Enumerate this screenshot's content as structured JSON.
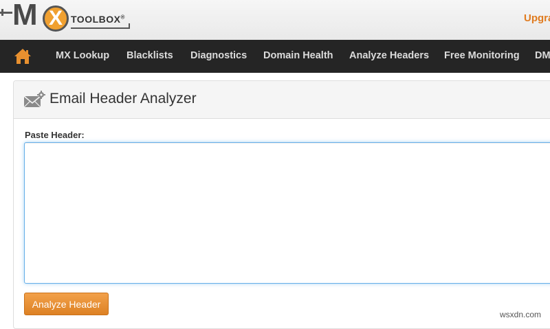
{
  "logo": {
    "brand_mx_m": "M",
    "brand_mx_x": "X",
    "brand_text": "TOOLBOX",
    "registered": "®"
  },
  "header": {
    "upgrade_label": "Upgra"
  },
  "nav": {
    "items": [
      {
        "label": "MX Lookup"
      },
      {
        "label": "Blacklists"
      },
      {
        "label": "Diagnostics"
      },
      {
        "label": "Domain Health"
      },
      {
        "label": "Analyze Headers"
      },
      {
        "label": "Free Monitoring"
      },
      {
        "label": "DM"
      }
    ]
  },
  "panel": {
    "title": "Email Header Analyzer",
    "field_label": "Paste Header:",
    "header_value": "",
    "button_label": "Analyze Header"
  },
  "watermark": "wsxdn.com",
  "colors": {
    "accent": "#e07b1f",
    "nav_bg": "#252525",
    "button": "#e8902f",
    "focus_border": "#66afe9"
  }
}
